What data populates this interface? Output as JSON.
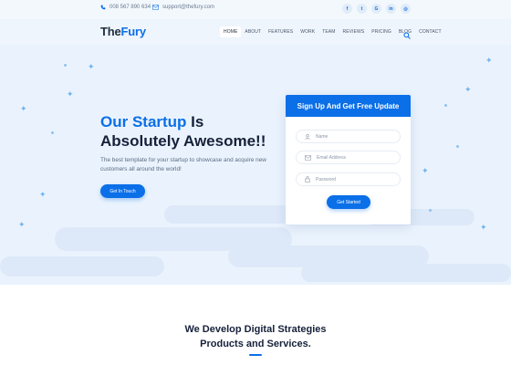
{
  "topbar": {
    "phone": "008 567 890 634",
    "email": "support@thefury.com",
    "socials": [
      {
        "icon": "facebook-icon",
        "glyph": "f"
      },
      {
        "icon": "twitter-icon",
        "glyph": "t"
      },
      {
        "icon": "google-plus-icon",
        "glyph": "G"
      },
      {
        "icon": "linkedin-icon",
        "glyph": "in"
      },
      {
        "icon": "instagram-icon",
        "glyph": "◎"
      }
    ]
  },
  "header": {
    "logo_part1": "The",
    "logo_part2": "Fury",
    "nav": [
      "HOME",
      "ABOUT",
      "FEATURES",
      "WORK",
      "TEAM",
      "REVIEWS",
      "PRICING",
      "BLOG",
      "CONTACT"
    ],
    "active_nav": "HOME"
  },
  "hero": {
    "title_blue": "Our Startup",
    "title_rest": " Is Absolutely Awesome!!",
    "text": "The best template for your startup to showcase and acquire new customers all around the world!",
    "cta": "Get In Touch"
  },
  "form": {
    "title": "Sign Up And Get Free Update",
    "name_placeholder": "Name",
    "email_placeholder": "Email Address",
    "password_placeholder": "Password",
    "submit": "Get Started"
  },
  "section": {
    "title_line1": "We Develop Digital Strategies",
    "title_line2": "Products and Services."
  },
  "colors": {
    "accent": "#0b6fe8",
    "hero_bg": "#eaf3fd",
    "heading": "#16213a"
  }
}
